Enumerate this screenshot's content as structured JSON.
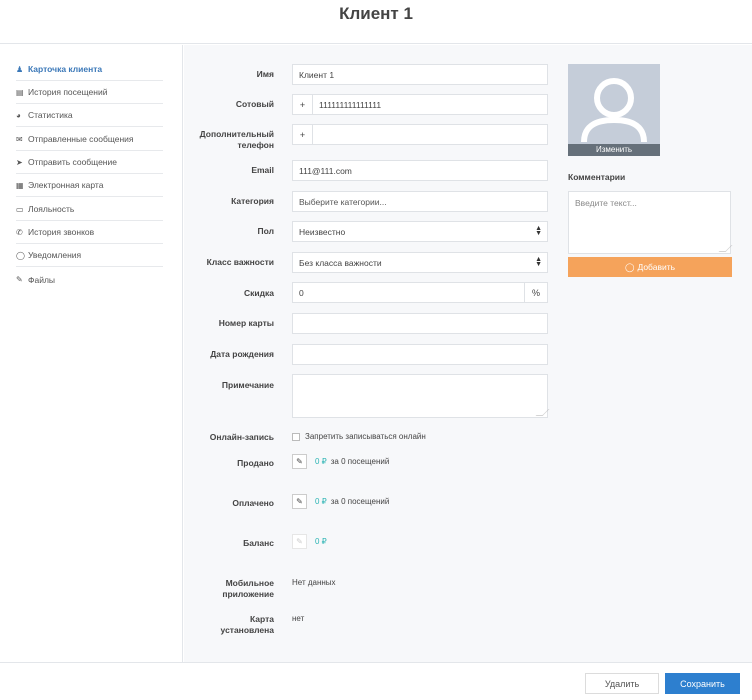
{
  "header": {
    "title": "Клиент 1"
  },
  "sidebar": {
    "items": [
      {
        "icon": "user-icon",
        "glyph": "♟",
        "label": "Карточка клиента"
      },
      {
        "icon": "list-icon",
        "glyph": "▤",
        "label": "История посещений"
      },
      {
        "icon": "pie-chart-icon",
        "glyph": "◕",
        "label": "Статистика"
      },
      {
        "icon": "envelope-icon",
        "glyph": "✉",
        "label": "Отправленные сообщения"
      },
      {
        "icon": "send-icon",
        "glyph": "➤",
        "label": "Отправить сообщение"
      },
      {
        "icon": "card-icon",
        "glyph": "▦",
        "label": "Электронная карта"
      },
      {
        "icon": "credit-card-icon",
        "glyph": "▭",
        "label": "Лояльность"
      },
      {
        "icon": "phone-icon",
        "glyph": "✆",
        "label": "История звонков"
      },
      {
        "icon": "bubble-icon",
        "glyph": "◯",
        "label": "Уведомления"
      },
      {
        "icon": "paperclip-icon",
        "glyph": "✎",
        "label": "Файлы"
      }
    ]
  },
  "form": {
    "name": {
      "label": "Имя",
      "value": "Клиент 1"
    },
    "mobile": {
      "label": "Сотовый",
      "prefix": "+",
      "value": "111111111111111"
    },
    "extra_phone": {
      "label_line1": "Дополнительный",
      "label_line2": "телефон",
      "prefix": "+",
      "value": ""
    },
    "email": {
      "label": "Email",
      "value": "111@111.com"
    },
    "category": {
      "label": "Категория",
      "placeholder": "Выберите категории..."
    },
    "gender": {
      "label": "Пол",
      "value": "Неизвестно"
    },
    "importance": {
      "label": "Класс важности",
      "value": "Без класса важности"
    },
    "discount": {
      "label": "Скидка",
      "value": "0",
      "suffix": "%"
    },
    "card_number": {
      "label": "Номер карты",
      "value": ""
    },
    "birthday": {
      "label": "Дата рождения",
      "value": ""
    },
    "note": {
      "label": "Примечание",
      "value": ""
    },
    "online_booking": {
      "label": "Онлайн-запись",
      "checkbox_label": "Запретить записываться онлайн",
      "checked": false
    },
    "sold": {
      "label": "Продано",
      "amount": "0 ₽",
      "text": "за 0 посещений"
    },
    "paid": {
      "label": "Оплачено",
      "amount": "0 ₽",
      "text": "за 0 посещений"
    },
    "balance": {
      "label": "Баланс",
      "amount": "0 ₽"
    },
    "mobile_app": {
      "label_line1": "Мобильное",
      "label_line2": "приложение",
      "value": "Нет данных"
    },
    "card_installed": {
      "label_line1": "Карта",
      "label_line2": "установлена",
      "value": "нет"
    }
  },
  "avatar": {
    "change_label": "Изменить"
  },
  "comments": {
    "title": "Комментарии",
    "placeholder": "Введите текст...",
    "add_label": "Добавить",
    "add_icon": "comment-icon"
  },
  "footer": {
    "delete_label": "Удалить",
    "save_label": "Сохранить"
  },
  "colors": {
    "accent": "#2d7fcf",
    "orange": "#f5a35b",
    "money": "#2ab3b3",
    "active_nav": "#3b78b8"
  }
}
